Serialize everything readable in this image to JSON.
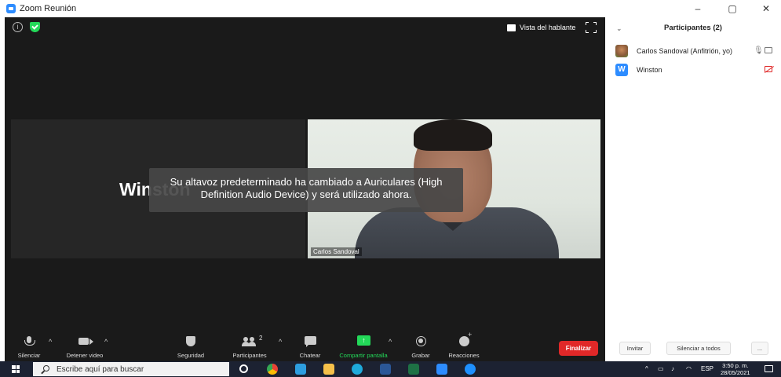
{
  "window": {
    "title": "Zoom Reunión",
    "minimize": "–",
    "maximize": "▢",
    "close": "✕"
  },
  "stage": {
    "view_button_label": "Vista del hablante",
    "left_tile_name": "Winston",
    "right_tile_name": "Carlos Sandoval",
    "toast_line1": "Su altavoz predeterminado ha cambiado a Auriculares (High",
    "toast_line2": "Definition Audio Device) y será utilizado ahora."
  },
  "toolbar": {
    "mute_label": "Silenciar",
    "stop_video_label": "Detener video",
    "security_label": "Seguridad",
    "participants_label": "Participantes",
    "participants_count": "2",
    "chat_label": "Chatear",
    "share_label": "Compartir pantalla",
    "record_label": "Grabar",
    "reactions_label": "Reacciones",
    "end_label": "Finalizar",
    "caret": "^"
  },
  "panel": {
    "title": "Participantes (2)",
    "participants": [
      {
        "name": "Carlos Sandoval (Anfitrión, yo)",
        "avatar": "photo",
        "mic": "on",
        "video": "on"
      },
      {
        "name": "Winston",
        "avatar_letter": "W",
        "video": "off"
      }
    ],
    "invite_label": "Invitar",
    "mute_all_label": "Silenciar a todos",
    "more_label": "..."
  },
  "taskbar": {
    "search_placeholder": "Escribe aquí para buscar",
    "language": "ESP",
    "time": "3:50 p. m.",
    "date": "28/05/2021"
  },
  "colors": {
    "accent_green": "#23d959",
    "end_red": "#e02828",
    "zoom_blue": "#2d8cff"
  }
}
